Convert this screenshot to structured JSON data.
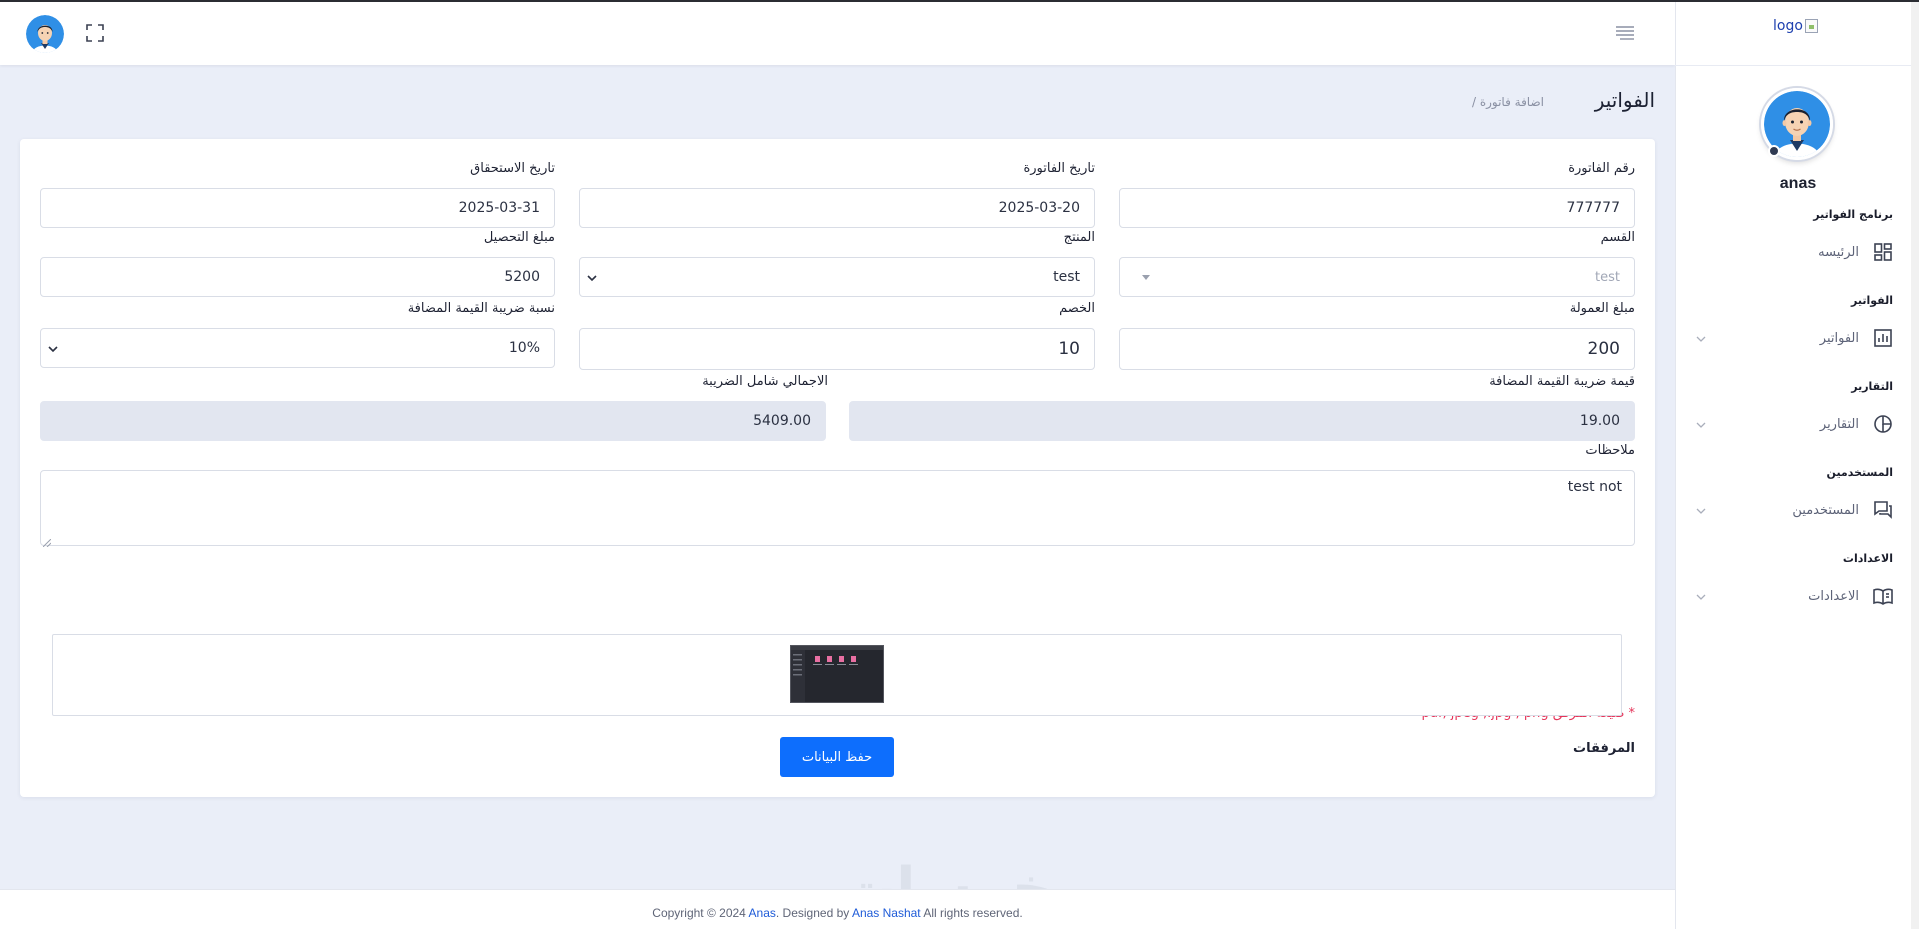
{
  "sidebar": {
    "logo_alt": "logo",
    "username": "anas",
    "sections": [
      {
        "title": "برنامج الفواتير",
        "item": "الرئيسه",
        "icon": "dashboard-icon",
        "has_chevron": false
      },
      {
        "title": "الفواتير",
        "item": "الفواتير",
        "icon": "bar-chart-icon",
        "has_chevron": true
      },
      {
        "title": "التقارير",
        "item": "التقارير",
        "icon": "pie-chart-icon",
        "has_chevron": true
      },
      {
        "title": "المستخدمين",
        "item": "المستخدمين",
        "icon": "chat-icon",
        "has_chevron": true
      },
      {
        "title": "الاعدادات",
        "item": "الاعدادات",
        "icon": "book-icon",
        "has_chevron": true
      }
    ]
  },
  "header": {
    "page_title": "الفواتير",
    "breadcrumb": "/ اضافة فاتورة"
  },
  "form": {
    "invoice_number": {
      "label": "رقم الفاتورة",
      "value": "777777"
    },
    "invoice_date": {
      "label": "تاريخ الفاتورة",
      "value": "2025-03-20"
    },
    "due_date": {
      "label": "تاريخ الاستحقاق",
      "value": "2025-03-31"
    },
    "section": {
      "label": "القسم",
      "value": "test"
    },
    "product": {
      "label": "المنتج",
      "value": "test"
    },
    "collection_amount": {
      "label": "مبلغ التحصيل",
      "value": "5200"
    },
    "commission_amount": {
      "label": "مبلغ العمولة",
      "value": "200"
    },
    "discount": {
      "label": "الخصم",
      "value": "10"
    },
    "vat_rate": {
      "label": "نسبة ضريبة القيمة المضافة",
      "value": "10%"
    },
    "vat_value": {
      "label": "قيمة ضريبة القيمة المضافة",
      "value": "19.00"
    },
    "total_with_tax": {
      "label": "الاجمالي شامل الضريبة",
      "value": "5409.00"
    },
    "notes": {
      "label": "ملاحظات",
      "value": "test not"
    },
    "attachment_hint": "* صيغة المرفق pdf, jpeg ,.jpg , png",
    "attachments_label": "المرفقات",
    "save_label": "حفظ البيانات"
  },
  "footer": {
    "prefix": "Copyright © 2024",
    "owner": "Anas",
    "designed_by": ". Designed by",
    "designer": "Anas Nashat",
    "suffix": "All rights reserved."
  },
  "watermark": "خمسات",
  "colors": {
    "primary": "#0d6efd",
    "hint": "#e5355a",
    "background": "#eaeef8"
  }
}
